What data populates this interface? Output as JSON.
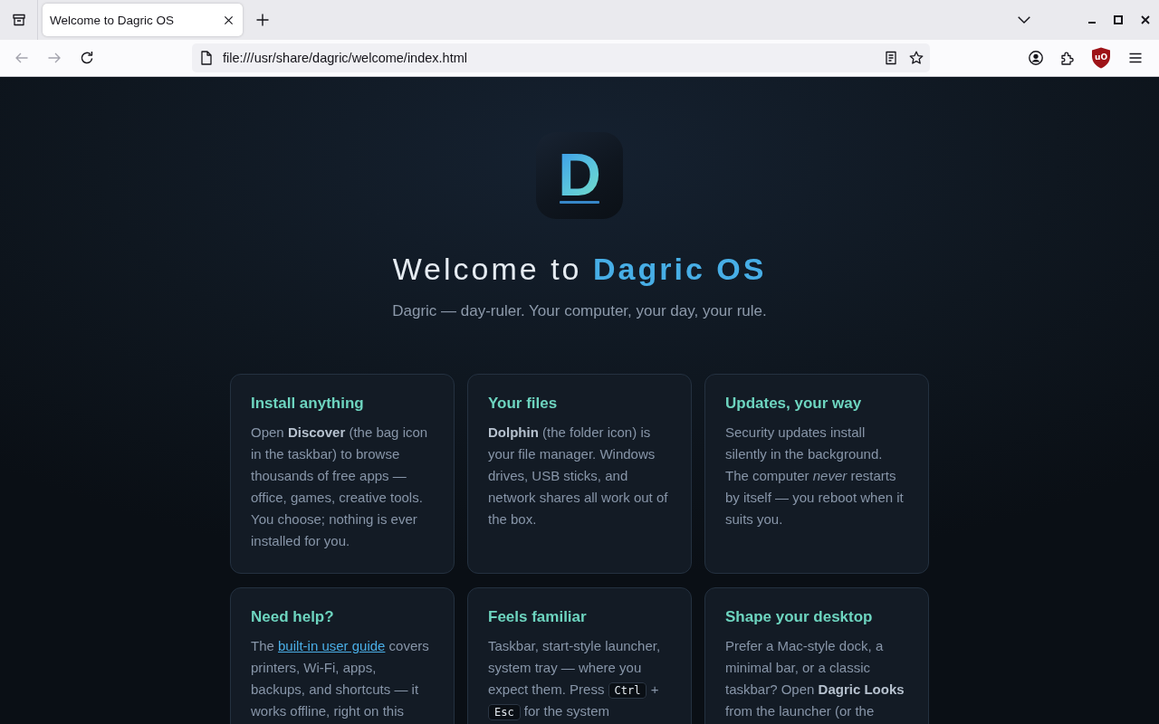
{
  "browser": {
    "tabs": [
      {
        "title": "Welcome to Dagric OS",
        "selected": true
      }
    ],
    "nav_buttons": [
      {
        "kind": "back",
        "disabled": true
      },
      {
        "kind": "forward",
        "disabled": true
      },
      {
        "kind": "reload",
        "disabled": false
      }
    ],
    "address_bar": {
      "url": "file:///usr/share/dagric/welcome/index.html"
    },
    "extension_badge": "uO"
  },
  "hero": {
    "logo_letter": "D",
    "title": "Welcome to **Dagric OS**",
    "tagline": "Dagric — day-ruler. Your computer, your day, your rule."
  },
  "cards": [
    {
      "title": "Install anything",
      "body": [
        {
          "kind": "text",
          "text": "Open **Discover** (the bag icon in the taskbar) to browse thousands of free apps — office, games, creative tools. You choose; nothing is ever installed for you."
        }
      ]
    },
    {
      "title": "Your files",
      "body": [
        {
          "kind": "text",
          "text": "**Dolphin** (the folder icon) is your file manager. Windows drives, USB sticks, and network shares all work out of the box."
        }
      ]
    },
    {
      "title": "Updates, your way",
      "body": [
        {
          "kind": "text",
          "text": "Security updates install silently in the background. The computer *never* restarts by itself — you reboot when it suits you."
        }
      ]
    },
    {
      "title": "Need help?",
      "body": [
        {
          "kind": "text",
          "text": "The"
        },
        {
          "kind": "link",
          "text": "built-in user guide"
        },
        {
          "kind": "text",
          "text": "covers printers, Wi-Fi, apps, backups, and shortcuts — it works offline, right on this"
        }
      ]
    },
    {
      "title": "Feels familiar",
      "body": [
        {
          "kind": "text",
          "text": "Taskbar, start-style launcher, system tray — where you expect them. Press"
        },
        {
          "kind": "key",
          "text": "Ctrl"
        },
        {
          "kind": "text",
          "text": "+"
        },
        {
          "kind": "key",
          "text": "Esc"
        },
        {
          "kind": "text",
          "text": "for the system"
        }
      ]
    },
    {
      "title": "Shape your desktop",
      "body": [
        {
          "kind": "text",
          "text": "Prefer a Mac-style dock, a minimal bar, or a classic taskbar? Open **Dagric Looks** from the launcher (or the"
        }
      ]
    }
  ]
}
